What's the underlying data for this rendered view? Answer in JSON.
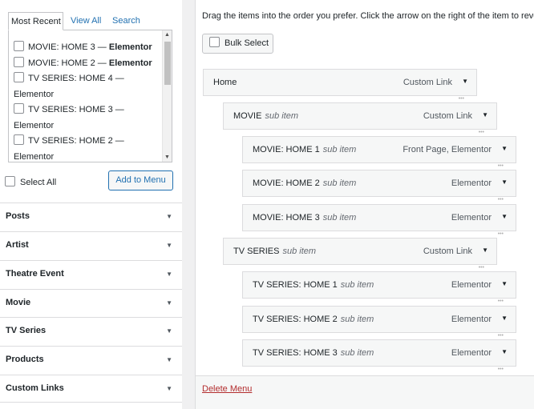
{
  "tabs": {
    "most_recent": "Most Recent",
    "view_all": "View All",
    "search": "Search"
  },
  "recent_items": [
    {
      "prefix": "MOVIE: HOME 3 — ",
      "suffix": "Elementor"
    },
    {
      "prefix": "MOVIE: HOME 2 — ",
      "suffix": "Elementor"
    },
    {
      "prefix": "TV SERIES: HOME 4 —",
      "suffix": "Elementor"
    },
    {
      "prefix": "TV SERIES: HOME 3 —",
      "suffix": "Elementor"
    },
    {
      "prefix": "TV SERIES: HOME 2 —",
      "suffix": "Elementor"
    }
  ],
  "select_all_label": "Select All",
  "add_to_menu_label": "Add to Menu",
  "accordion": [
    "Posts",
    "Artist",
    "Theatre Event",
    "Movie",
    "TV Series",
    "Products",
    "Custom Links"
  ],
  "instructions": "Drag the items into the order you prefer. Click the arrow on the right of the item to reveal additional configuration options.",
  "bulk_select_label": "Bulk Select",
  "menu_items": [
    {
      "title": "Home",
      "sub": "",
      "type": "Custom Link"
    },
    {
      "title": "MOVIE",
      "sub": "sub item",
      "type": "Custom Link"
    },
    {
      "title": "MOVIE: HOME 1",
      "sub": "sub item",
      "type": "Front Page, Elementor"
    },
    {
      "title": "MOVIE: HOME 2",
      "sub": "sub item",
      "type": "Elementor"
    },
    {
      "title": "MOVIE: HOME 3",
      "sub": "sub item",
      "type": "Elementor"
    },
    {
      "title": "TV SERIES",
      "sub": "sub item",
      "type": "Custom Link"
    },
    {
      "title": "TV SERIES: HOME 1",
      "sub": "sub item",
      "type": "Elementor"
    },
    {
      "title": "TV SERIES: HOME 2",
      "sub": "sub item",
      "type": "Elementor"
    },
    {
      "title": "TV SERIES: HOME 3",
      "sub": "sub item",
      "type": "Elementor"
    }
  ],
  "delete_menu_label": "Delete Menu",
  "icons": {
    "dropdown": "triangle-down-icon",
    "scroll_up": "scroll-up-icon",
    "scroll_down": "scroll-down-icon"
  }
}
